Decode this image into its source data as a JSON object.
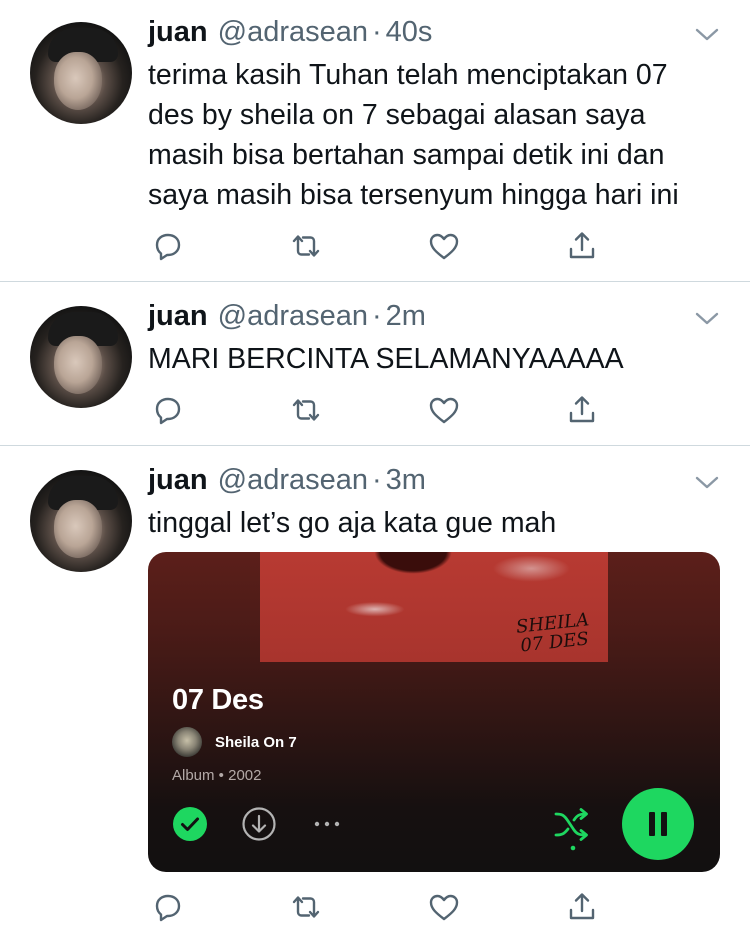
{
  "tweets": [
    {
      "name": "juan",
      "handle": "@adrasean",
      "separator": "·",
      "time": "40s",
      "lines": [
        "terima kasih Tuhan telah menciptakan 07",
        "des by sheila on 7 sebagai alasan saya",
        "masih bisa bertahan sampai detik ini dan",
        "saya masih bisa tersenyum hingga hari ini"
      ]
    },
    {
      "name": "juan",
      "handle": "@adrasean",
      "separator": "·",
      "time": "2m",
      "lines": [
        "MARI BERCINTA SELAMANYAAAAA"
      ]
    },
    {
      "name": "juan",
      "handle": "@adrasean",
      "separator": "·",
      "time": "3m",
      "lines": [
        "tinggal let’s go aja kata gue mah"
      ],
      "spotify_card": {
        "cover_script": "SHEILA\n07 DES",
        "album_title": "07 Des",
        "artist": "Sheila On 7",
        "meta": "Album • 2002",
        "accent_color": "#1ed760",
        "controls": [
          "saved-check-icon",
          "download-icon",
          "more-icon",
          "shuffle-icon",
          "pause-icon"
        ]
      }
    }
  ],
  "action_icons": [
    "reply-icon",
    "retweet-icon",
    "like-icon",
    "share-icon"
  ],
  "colors": {
    "text": "#0f1419",
    "secondary": "#536471",
    "divider": "#cfd9de"
  }
}
